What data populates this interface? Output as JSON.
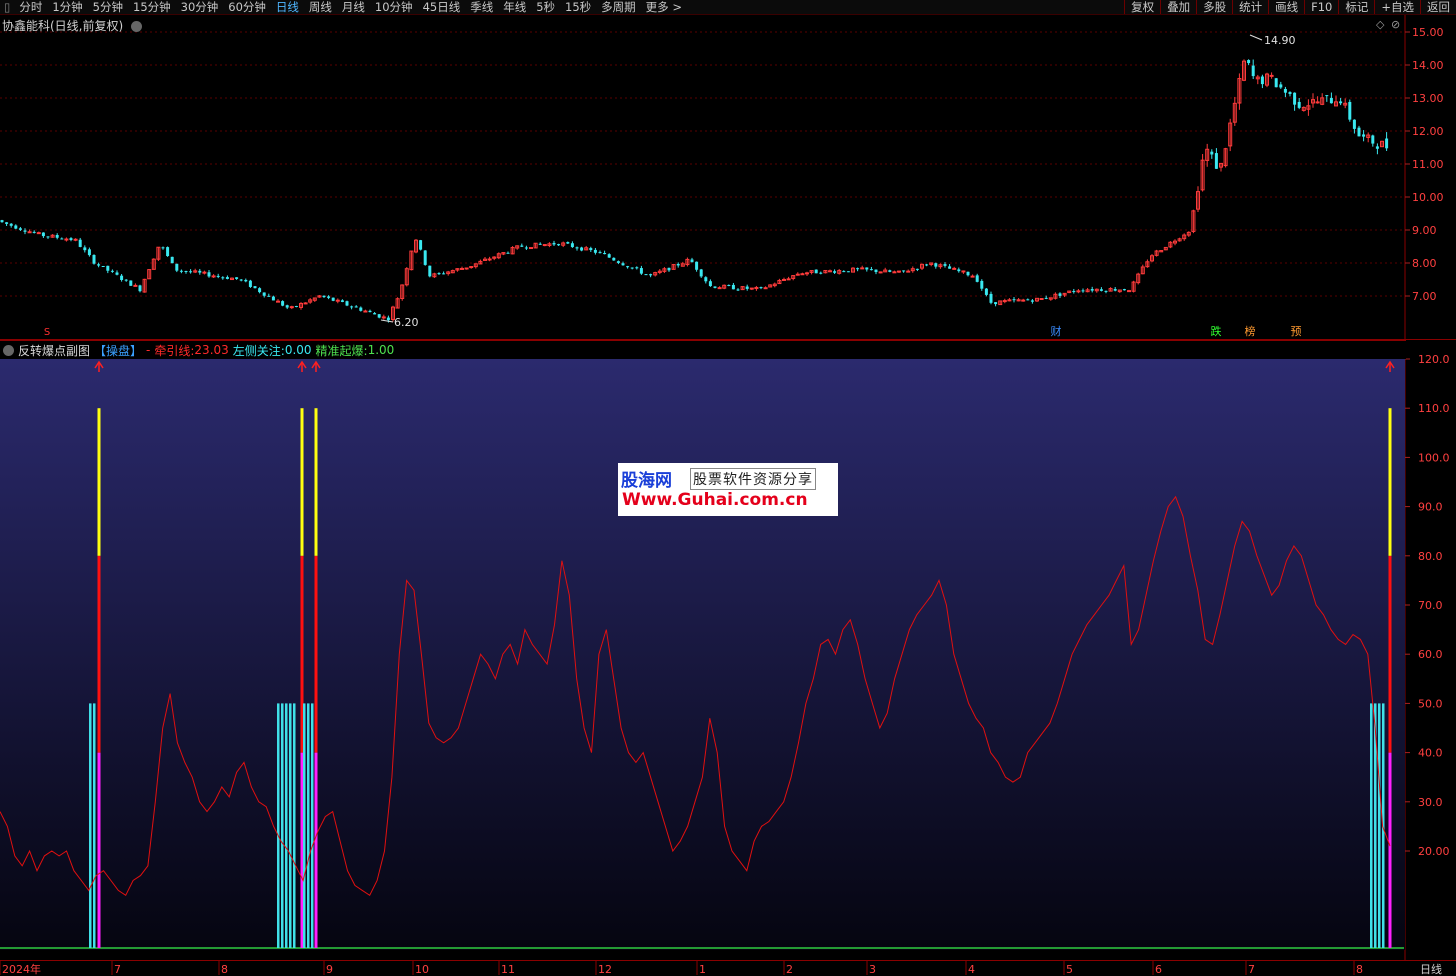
{
  "toolbar": {
    "left_items": [
      "分时",
      "1分钟",
      "5分钟",
      "15分钟",
      "30分钟",
      "60分钟",
      "日线",
      "周线",
      "月线",
      "10分钟",
      "45日线",
      "季线",
      "年线",
      "5秒",
      "15秒",
      "多周期",
      "更多 >"
    ],
    "active": "日线",
    "right_items": [
      "复权",
      "叠加",
      "多股",
      "统计",
      "画线",
      "F10",
      "标记",
      "+自选",
      "返回"
    ]
  },
  "main_chart": {
    "title": "协鑫能科(日线,前复权)",
    "high_label": "14.90",
    "low_label": "6.20",
    "price_axis": [
      "15.00",
      "14.00",
      "13.00",
      "12.00",
      "11.00",
      "10.00",
      "9.00",
      "8.00",
      "7.00"
    ],
    "markers": {
      "s1": "S",
      "cai": "财",
      "die": "跌",
      "bang": "榜",
      "yu": "预"
    },
    "colors": {
      "up": "#ff3b3b",
      "down": "#3ae8f0"
    }
  },
  "indicator": {
    "name": "反转爆点副图",
    "tag": "【操盘】",
    "dash": "-",
    "line1_label": "牵引线:",
    "line1_value": "23.03",
    "line2_label": "左侧关注:",
    "line2_value": "0.00",
    "line3_label": "精准起爆:",
    "line3_value": "1.00",
    "axis": [
      "120.0",
      "110.0",
      "100.0",
      "90.0",
      "80.0",
      "70.0",
      "60.0",
      "50.0",
      "40.0",
      "30.0",
      "20.00"
    ],
    "chart_data": {
      "type": "line",
      "series": [
        {
          "name": "牵引线",
          "color": "#e01010",
          "values": [
            28,
            25,
            19,
            17,
            20,
            16,
            19,
            20,
            19,
            20,
            16,
            14,
            12,
            15,
            16,
            14,
            12,
            11,
            14,
            15,
            17,
            30,
            45,
            52,
            42,
            38,
            35,
            30,
            28,
            30,
            33,
            31,
            36,
            38,
            33,
            30,
            29,
            25,
            22,
            20,
            17,
            14,
            20,
            24,
            27,
            28,
            22,
            16,
            13,
            12,
            11,
            14,
            20,
            35,
            60,
            75,
            73,
            60,
            46,
            43,
            42,
            43,
            45,
            50,
            55,
            60,
            58,
            55,
            60,
            62,
            58,
            65,
            62,
            60,
            58,
            66,
            79,
            72,
            55,
            45,
            40,
            60,
            65,
            55,
            45,
            40,
            38,
            40,
            35,
            30,
            25,
            20,
            22,
            25,
            30,
            35,
            47,
            40,
            25,
            20,
            18,
            16,
            22,
            25,
            26,
            28,
            30,
            35,
            42,
            50,
            55,
            62,
            63,
            60,
            65,
            67,
            62,
            55,
            50,
            45,
            48,
            55,
            60,
            65,
            68,
            70,
            72,
            75,
            70,
            60,
            55,
            50,
            47,
            45,
            40,
            38,
            35,
            34,
            35,
            40,
            42,
            44,
            46,
            50,
            55,
            60,
            63,
            66,
            68,
            70,
            72,
            75,
            78,
            62,
            65,
            72,
            79,
            85,
            90,
            92,
            88,
            80,
            73,
            63,
            62,
            68,
            75,
            82,
            87,
            85,
            80,
            76,
            72,
            74,
            79,
            82,
            80,
            75,
            70,
            68,
            65,
            63,
            62,
            64,
            63,
            60,
            45,
            25,
            21
          ]
        },
        {
          "name": "左侧关注",
          "color": "#40e0e8"
        },
        {
          "name": "精准起爆",
          "color": "#ffff00"
        }
      ]
    },
    "signals": [
      {
        "pos": 99,
        "strong": true,
        "cyan": [
          89,
          95
        ]
      },
      {
        "pos": 302,
        "strong": true,
        "cyan": [
          277,
          296
        ]
      },
      {
        "pos": 316,
        "strong": true,
        "cyan": [
          303,
          312
        ]
      },
      {
        "pos": 1390,
        "strong": true,
        "cyan": [
          1370,
          1385
        ]
      }
    ]
  },
  "time_axis": {
    "labels": [
      {
        "x": 20,
        "t": "2024年"
      },
      {
        "x": 115,
        "t": "7"
      },
      {
        "x": 222,
        "t": "8"
      },
      {
        "x": 327,
        "t": "9"
      },
      {
        "x": 416,
        "t": "10"
      },
      {
        "x": 502,
        "t": "11"
      },
      {
        "x": 599,
        "t": "12"
      },
      {
        "x": 700,
        "t": "1"
      },
      {
        "x": 787,
        "t": "2"
      },
      {
        "x": 870,
        "t": "3"
      },
      {
        "x": 969,
        "t": "4"
      },
      {
        "x": 1067,
        "t": "5"
      },
      {
        "x": 1156,
        "t": "6"
      },
      {
        "x": 1249,
        "t": "7"
      },
      {
        "x": 1357,
        "t": "8"
      }
    ],
    "period": "日线"
  },
  "watermark": {
    "logo": "股海网",
    "slogan": "股票软件资源分享",
    "url": "Www.Guhai.com.cn"
  }
}
